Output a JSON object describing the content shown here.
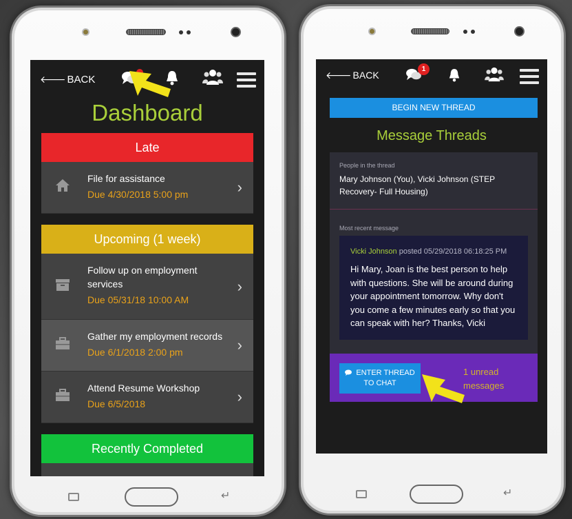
{
  "left_screen": {
    "back_label": "BACK",
    "back_arrow": "🡐",
    "title": "Dashboard",
    "sections": {
      "late": {
        "heading": "Late",
        "tasks": [
          {
            "title": "File for assistance",
            "due": "Due 4/30/2018 5:00 pm",
            "icon": "home-icon"
          }
        ]
      },
      "upcoming": {
        "heading": "Upcoming (1 week)",
        "tasks": [
          {
            "title": "Follow up on employment services",
            "due": "Due 05/31/18 10:00 AM",
            "icon": "archive-box-icon"
          },
          {
            "title": "Gather my employment records",
            "due": "Due 6/1/2018 2:00 pm",
            "icon": "briefcase-icon"
          },
          {
            "title": "Attend Resume Workshop",
            "due": "Due 6/5/2018",
            "icon": "briefcase-icon"
          }
        ]
      },
      "completed": {
        "heading": "Recently Completed"
      }
    }
  },
  "right_screen": {
    "back_label": "BACK",
    "chat_badge": "1",
    "begin_button": "BEGIN NEW THREAD",
    "title": "Message Threads",
    "people_label": "People in the thread",
    "people": "Mary Johnson (You), Vicki Johnson (STEP Recovery- Full Housing)",
    "recent_label": "Most recent message",
    "sender": "Vicki Johnson",
    "posted_meta": " posted 05/29/2018 06:18:25 PM",
    "message": "Hi Mary, Joan is the best person to help with questions. She will be around during your appointment tomorrow. Why don't you come a few minutes early so that you can speak with her? Thanks, Vicki",
    "enter_button": "ENTER THREAD TO CHAT",
    "unread": "1 unread messages"
  },
  "colors": {
    "late": "#e8262a",
    "upcoming": "#d9b018",
    "completed": "#12c23c",
    "title_green": "#a9cf3a",
    "due_orange": "#e9a21a",
    "button_blue": "#1b8fe0",
    "enter_bar_purple": "#6a2ab8",
    "pointer_yellow": "#f2e21a"
  }
}
